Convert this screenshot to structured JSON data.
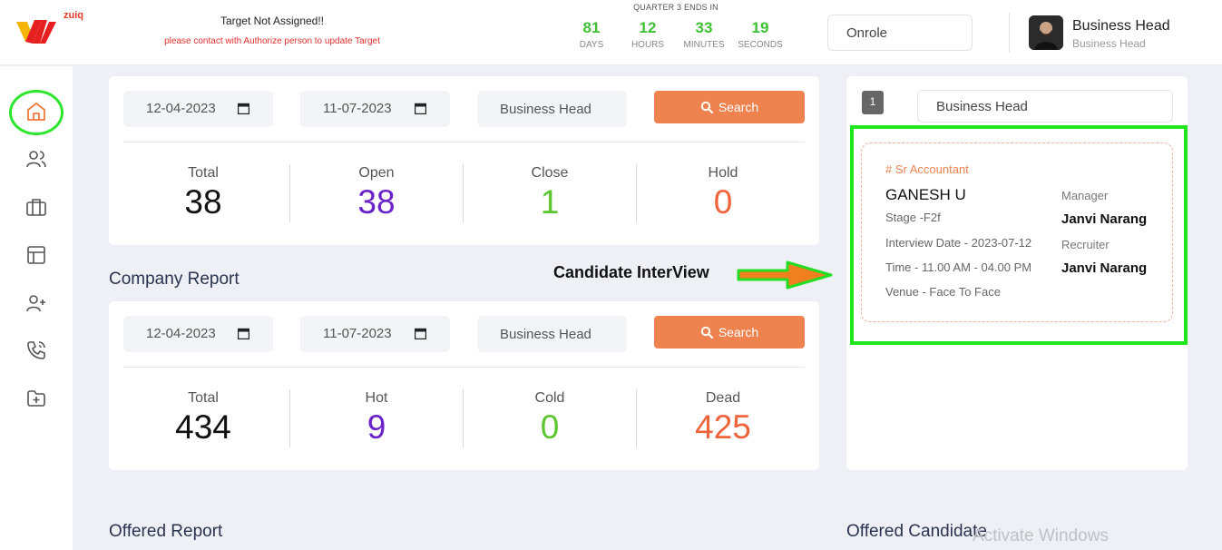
{
  "header": {
    "logo_text": "zuiq",
    "target_title": "Target Not Assigned!!",
    "target_message": "please contact with Authorize person to update Target",
    "countdown_title": "QUARTER 3 ENDS IN",
    "countdown": [
      {
        "value": "81",
        "label": "DAYS"
      },
      {
        "value": "12",
        "label": "HOURS"
      },
      {
        "value": "33",
        "label": "MINUTES"
      },
      {
        "value": "19",
        "label": "SECONDS"
      }
    ],
    "role_selector": "Onrole",
    "user_name": "Business Head",
    "user_role": "Business Head"
  },
  "sidebar": {
    "items": [
      {
        "icon": "home-icon",
        "active": true
      },
      {
        "icon": "users-icon"
      },
      {
        "icon": "briefcase-icon"
      },
      {
        "icon": "layout-icon"
      },
      {
        "icon": "user-plus-icon"
      },
      {
        "icon": "phone-call-icon"
      },
      {
        "icon": "folder-plus-icon"
      }
    ]
  },
  "job_report": {
    "from_date": "12-04-2023",
    "to_date": "11-07-2023",
    "role": "Business Head",
    "search_label": "Search",
    "stats": [
      {
        "label": "Total",
        "value": "38",
        "color": "#111111"
      },
      {
        "label": "Open",
        "value": "38",
        "color": "#6a22c9"
      },
      {
        "label": "Close",
        "value": "1",
        "color": "#5cc62e"
      },
      {
        "label": "Hold",
        "value": "0",
        "color": "#f0643c"
      }
    ]
  },
  "company_report": {
    "title": "Company Report",
    "from_date": "12-04-2023",
    "to_date": "11-07-2023",
    "role": "Business Head",
    "search_label": "Search",
    "stats": [
      {
        "label": "Total",
        "value": "434",
        "color": "#111111"
      },
      {
        "label": "Hot",
        "value": "9",
        "color": "#6a22c9"
      },
      {
        "label": "Cold",
        "value": "0",
        "color": "#5cc62e"
      },
      {
        "label": "Dead",
        "value": "425",
        "color": "#f0643c"
      }
    ]
  },
  "annotation": {
    "label": "Candidate InterView",
    "arrow_color": "#f07f1e",
    "arrow_outline": "#22dd22"
  },
  "interview_panel": {
    "page": "1",
    "role": "Business Head",
    "candidate": {
      "position": "# Sr Accountant",
      "name": "GANESH U",
      "stage": "Stage -F2f",
      "interview_date": "Interview Date - 2023-07-12",
      "time": "Time - 11.00 AM - 04.00 PM",
      "venue": "Venue - Face To Face",
      "manager_label": "Manager",
      "manager_name": "Janvi Narang",
      "recruiter_label": "Recruiter",
      "recruiter_name": "Janvi Narang"
    }
  },
  "offered_report": {
    "title": "Offered Report"
  },
  "offered_candidate": {
    "title": "Offered Candidate"
  },
  "watermark": "Activate Windows"
}
